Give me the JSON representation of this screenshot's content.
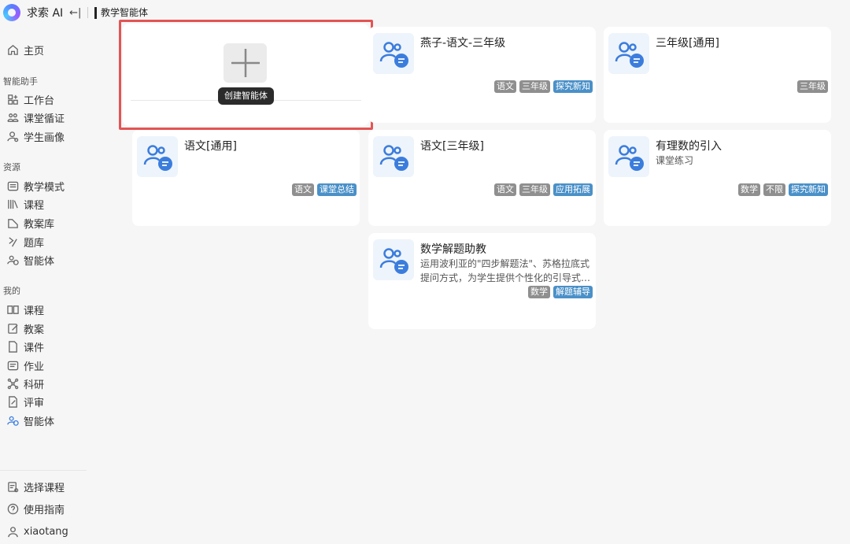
{
  "app": {
    "name": "求索 AI",
    "breadcrumb": "教学智能体"
  },
  "sidebar": {
    "home": "主页",
    "sections": [
      {
        "title": "智能助手",
        "items": [
          "工作台",
          "课堂循证",
          "学生画像"
        ]
      },
      {
        "title": "资源",
        "items": [
          "教学模式",
          "课程",
          "教案库",
          "题库",
          "智能体"
        ]
      },
      {
        "title": "我的",
        "items": [
          "课程",
          "教案",
          "课件",
          "作业",
          "科研",
          "评审",
          "智能体"
        ]
      }
    ],
    "bottom": [
      "选择课程",
      "使用指南",
      "xiaotang"
    ]
  },
  "create_card": {
    "tooltip": "创建智能体"
  },
  "agents": [
    {
      "title": "燕子-语文-三年级",
      "desc": [],
      "tags": [
        {
          "text": "语文",
          "color": "gray"
        },
        {
          "text": "三年级",
          "color": "gray"
        },
        {
          "text": "探究新知",
          "color": "blue"
        }
      ]
    },
    {
      "title": "三年级[通用]",
      "desc": [],
      "tags": [
        {
          "text": "三年级",
          "color": "gray"
        }
      ]
    },
    {
      "title": "语文[通用]",
      "desc": [],
      "tags": [
        {
          "text": "语文",
          "color": "gray"
        },
        {
          "text": "课堂总结",
          "color": "blue"
        }
      ]
    },
    {
      "title": "语文[三年级]",
      "desc": [],
      "tags": [
        {
          "text": "语文",
          "color": "gray"
        },
        {
          "text": "三年级",
          "color": "gray"
        },
        {
          "text": "应用拓展",
          "color": "blue"
        }
      ]
    },
    {
      "title": "有理数的引入",
      "desc": [
        "课堂练习"
      ],
      "tags": [
        {
          "text": "数学",
          "color": "gray"
        },
        {
          "text": "不限",
          "color": "gray"
        },
        {
          "text": "探究新知",
          "color": "blue"
        }
      ]
    },
    {
      "title": "数学解题助教",
      "desc": [
        "运用波利亚的\"四步解题法\"、苏格拉底式",
        "提问方式，为学生提供个性化的引导式…"
      ],
      "tags": [
        {
          "text": "数学",
          "color": "gray"
        },
        {
          "text": "解题辅导",
          "color": "blue"
        }
      ]
    }
  ],
  "colors": {
    "accent": "#3b7ddd",
    "highlight": "#e45454",
    "tag_gray": "#8f8f8f",
    "tag_blue": "#4a90c8"
  }
}
